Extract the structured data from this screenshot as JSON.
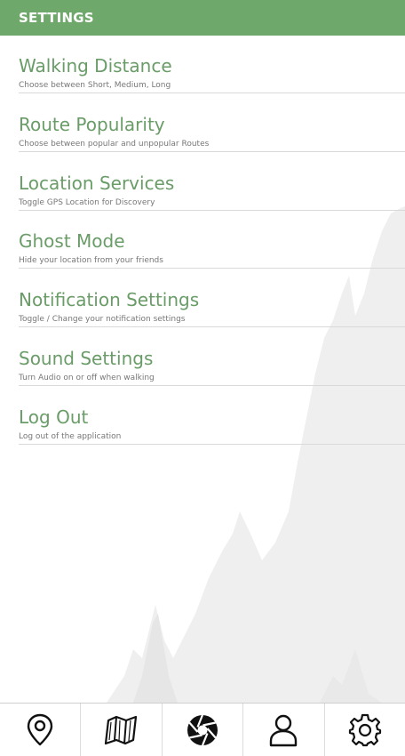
{
  "header": {
    "title": "SETTINGS"
  },
  "menu": {
    "items": [
      {
        "title": "Walking Distance",
        "description": "Choose between Short, Medium, Long"
      },
      {
        "title": "Route Popularity",
        "description": "Choose between popular and unpopular Routes"
      },
      {
        "title": "Location Services",
        "description": "Toggle GPS Location for Discovery"
      },
      {
        "title": "Ghost Mode",
        "description": "Hide your location from your friends"
      },
      {
        "title": "Notification Settings",
        "description": "Toggle / Change your notification settings"
      },
      {
        "title": "Sound Settings",
        "description": "Turn Audio on or off when walking"
      },
      {
        "title": "Log Out",
        "description": "Log out of the application"
      }
    ]
  },
  "nav": {
    "items": [
      {
        "icon": "location-pin-icon"
      },
      {
        "icon": "map-icon"
      },
      {
        "icon": "camera-aperture-icon"
      },
      {
        "icon": "profile-icon"
      },
      {
        "icon": "gear-icon"
      }
    ]
  },
  "colors": {
    "header_bg": "#6fa86b",
    "item_title": "#6a9c68",
    "item_desc": "#777777",
    "mountain": "#efefef"
  }
}
